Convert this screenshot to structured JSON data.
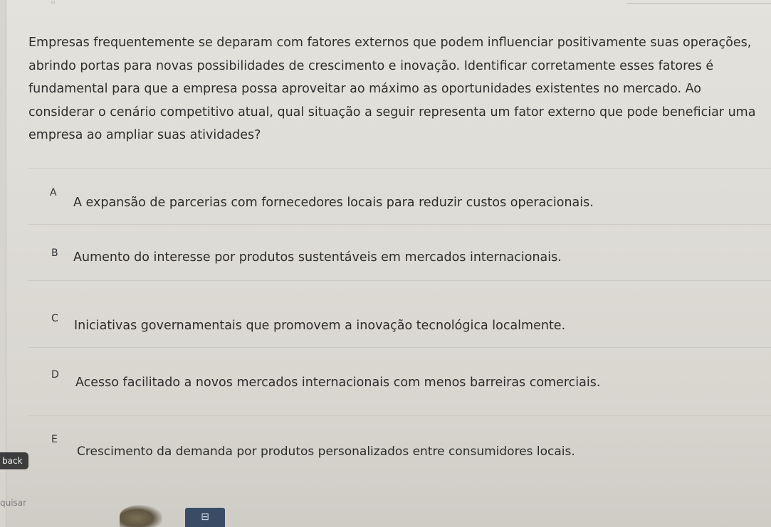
{
  "question": {
    "text": "Empresas frequentemente se deparam com fatores externos que podem influenciar positivamente suas operações, abrindo portas para novas possibilidades de crescimento e inovação. Identificar corretamente esses fatores é fundamental para que a empresa possa aproveitar ao máximo as oportunidades existentes no mercado. Ao considerar o cenário competitivo atual, qual situação a seguir representa um fator externo que pode beneficiar uma empresa ao ampliar suas atividades?"
  },
  "options": [
    {
      "letter": "A",
      "text": "A expansão de parcerias com fornecedores locais para reduzir custos operacionais."
    },
    {
      "letter": "B",
      "text": "Aumento do interesse por produtos sustentáveis em mercados internacionais."
    },
    {
      "letter": "C",
      "text": "Iniciativas governamentais que promovem a inovação tecnológica localmente."
    },
    {
      "letter": "D",
      "text": "Acesso facilitado a novos mercados internacionais com menos barreiras comerciais."
    },
    {
      "letter": "E",
      "text": "Crescimento da demanda por produtos personalizados entre consumidores locais."
    }
  ],
  "nav": {
    "back_label": "back",
    "quit_label": "quisar"
  },
  "taskbar": {
    "app_icon_name": "app-icon"
  },
  "colors": {
    "background": "#dedcd6",
    "back_button": "#3d3d3d",
    "text": "#2c2c2c"
  }
}
